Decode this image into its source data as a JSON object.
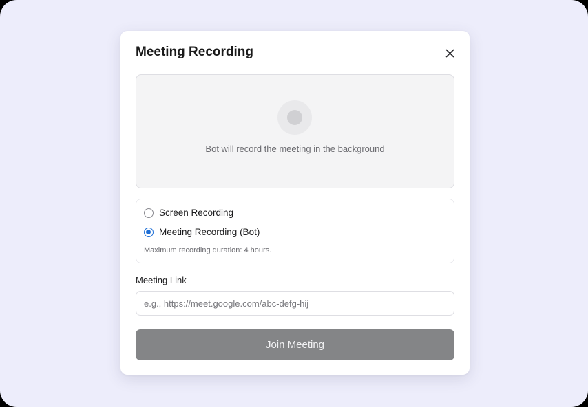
{
  "dialog": {
    "title": "Meeting Recording",
    "close_icon": "close-icon"
  },
  "preview": {
    "icon": "record-icon",
    "message": "Bot will record the meeting in the background"
  },
  "recording_options": {
    "items": [
      {
        "label": "Screen Recording",
        "selected": false
      },
      {
        "label": "Meeting Recording (Bot)",
        "selected": true
      }
    ],
    "note": "Maximum recording duration: 4 hours."
  },
  "meeting_link": {
    "label": "Meeting Link",
    "value": "",
    "placeholder": "e.g., https://meet.google.com/abc-defg-hij"
  },
  "actions": {
    "join_label": "Join Meeting"
  },
  "colors": {
    "backdrop": "#ededfb",
    "accent": "#1f6fd6",
    "button_disabled": "#848587"
  }
}
